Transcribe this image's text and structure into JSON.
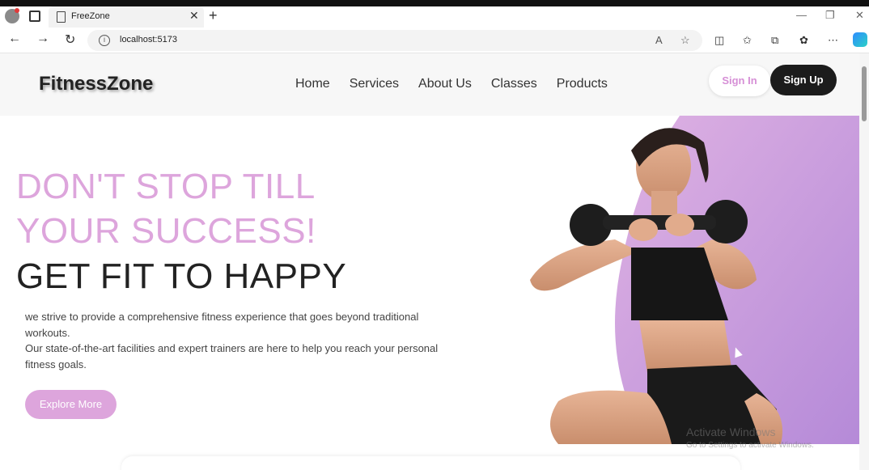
{
  "browser": {
    "tab_title": "FreeZone",
    "url": "localhost:5173",
    "close_glyph": "✕",
    "new_tab_glyph": "+"
  },
  "header": {
    "logo": "FitnessZone",
    "nav": [
      "Home",
      "Services",
      "About Us",
      "Classes",
      "Products"
    ],
    "signin": "Sign In",
    "signup": "Sign Up"
  },
  "hero": {
    "line1": "DON'T STOP TILL",
    "line2": "YOUR SUCCESS!",
    "line3": "GET FIT TO HAPPY",
    "desc1": "we strive to provide a comprehensive fitness experience that goes beyond traditional workouts.",
    "desc2": "Our state-of-the-art facilities and expert trainers are here to help you reach your personal fitness goals.",
    "cta": "Explore More"
  },
  "os_watermark": {
    "title": "Activate Windows",
    "subtitle": "Go to Settings to activate Windows."
  },
  "colors": {
    "accent_pink": "#dda5dc",
    "dark": "#1c1c1c"
  }
}
